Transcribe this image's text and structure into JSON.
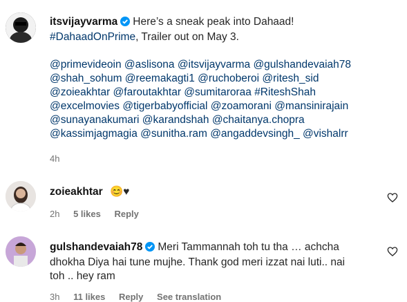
{
  "post": {
    "username": "itsvijayvarma",
    "line1": "Here’s a sneak peak into Dahaad!",
    "hashtag": "#DahaadOnPrime",
    "line2_rest": ", Trailer out on May 3.",
    "mentions": [
      "@primevideoin @aslisona @itsvijayvarma @gulshandevaiah78",
      "@shah_sohum @reemakagti1 @ruchoberoi @ritesh_sid",
      "@zoieakhtar @faroutakhtar @sumitaroraa #RiteshShah",
      "@excelmovies @tigerbabyofficial @zoamorani @mansinirajain",
      "@sunayanakumari @karandshah @chaitanya.chopra",
      "@kassimjagmagia @sunitha.ram @angaddevsingh_ @vishalrr"
    ],
    "time": "4h"
  },
  "comments": [
    {
      "username": "zoieakhtar",
      "text": "😊♥",
      "time": "2h",
      "likes": "5 likes",
      "reply": "Reply"
    },
    {
      "username": "gulshandevaiah78",
      "lines": [
        "Meri Tammannah toh tu tha … achcha",
        "dhokha Diya hai tune mujhe. Thank god meri izzat nai luti.. nai",
        "toh .. hey ram"
      ],
      "time": "3h",
      "likes": "11 likes",
      "reply": "Reply",
      "see_translation": "See translation"
    }
  ],
  "icons": {
    "verified": "verified-badge-icon",
    "like": "heart-outline-icon"
  },
  "colors": {
    "link": "#00376b",
    "verified": "#0095f6",
    "meta": "#737373"
  }
}
